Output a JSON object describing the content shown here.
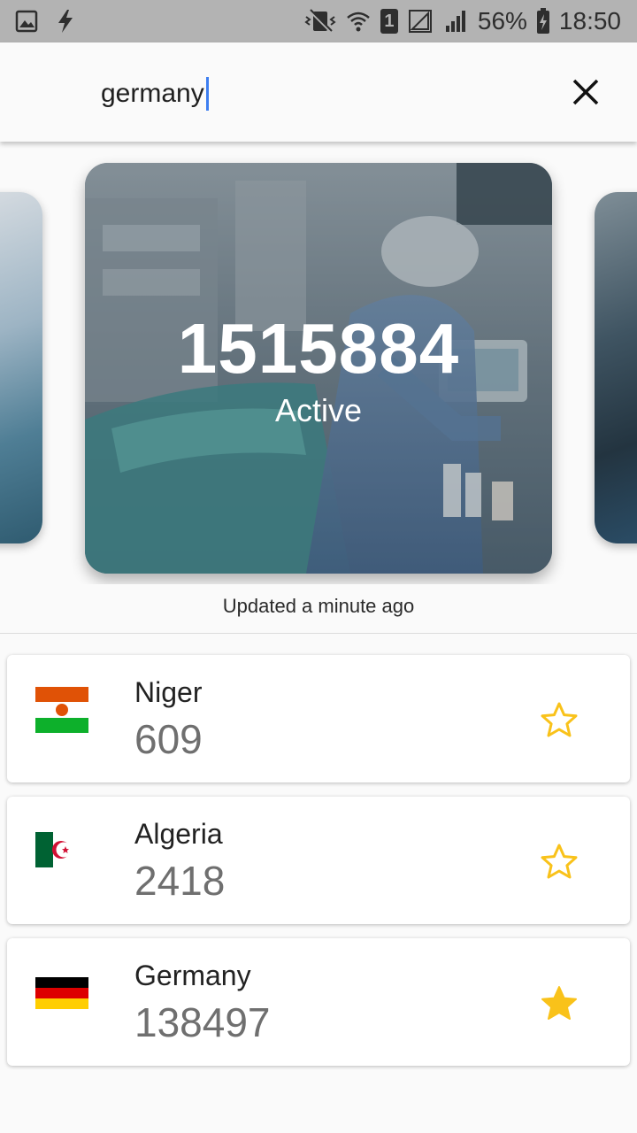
{
  "status_bar": {
    "battery": "56%",
    "time": "18:50",
    "sim_badge": "1",
    "icons": [
      "image-icon",
      "flash-icon",
      "vibrate-icon",
      "wifi-icon",
      "sim-icon",
      "signal-icon",
      "signal-icon",
      "battery-charging-icon"
    ]
  },
  "search": {
    "query": "germany",
    "close_icon": "close-icon"
  },
  "carousel": {
    "main_card": {
      "value": "1515884",
      "label": "Active"
    }
  },
  "updated_text": "Updated a minute ago",
  "countries": [
    {
      "name": "Niger",
      "count": "609",
      "flag": "niger-flag-icon",
      "favorite": false
    },
    {
      "name": "Algeria",
      "count": "2418",
      "flag": "algeria-flag-icon",
      "favorite": false
    },
    {
      "name": "Germany",
      "count": "138497",
      "flag": "germany-flag-icon",
      "favorite": true
    }
  ],
  "colors": {
    "star": "#f9c21a",
    "accent_cursor": "#3d7ef0",
    "status_bar": "#b3b3b3"
  }
}
